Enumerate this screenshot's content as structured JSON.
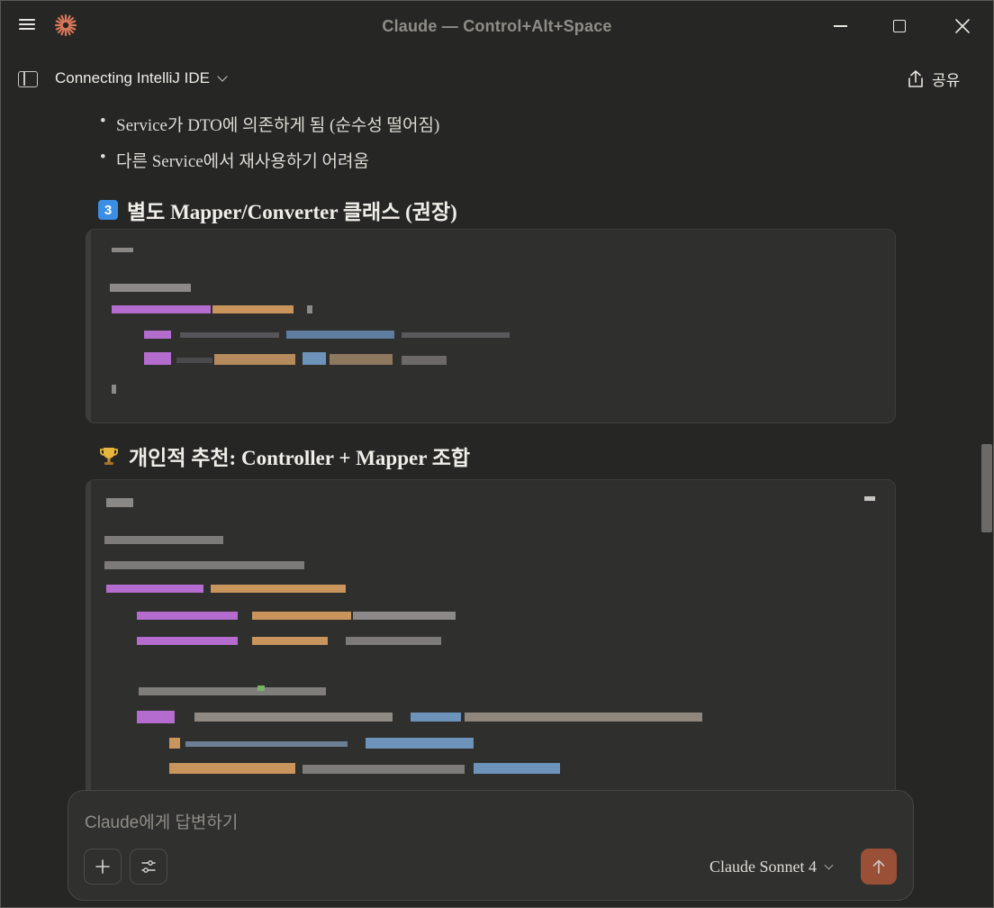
{
  "window": {
    "title": "Claude — Control+Alt+Space"
  },
  "header": {
    "chat_title": "Connecting IntelliJ IDE",
    "share_label": "공유"
  },
  "conversation": {
    "bullets": [
      "Service가 DTO에 의존하게 됨 (순수성 떨어짐)",
      "다른 Service에서 재사용하기 어려움"
    ],
    "section_3": {
      "badge": "3",
      "title": "별도 Mapper/Converter 클래스 (권장)"
    },
    "recommendation": {
      "title": "개인적 추천: Controller + Mapper 조합"
    }
  },
  "composer": {
    "placeholder": "Claude에게 답변하기",
    "model": "Claude Sonnet 4"
  },
  "colors": {
    "background": "#262624",
    "code_background": "#2f2f2d",
    "accent_send": "#b2573a",
    "badge_blue": "#3a8ee6",
    "code_purple": "#c07fd6",
    "code_orange": "#d6a06a",
    "code_blue": "#6ea8e0",
    "code_gray": "#a5a3a0"
  },
  "icons": {
    "menu": "hamburger-icon",
    "logo": "claude-asterisk-icon",
    "minimize": "minimize-icon",
    "maximize": "maximize-icon",
    "close": "close-icon",
    "sidebar": "sidebar-icon",
    "share": "share-icon",
    "plus": "plus-icon",
    "tune": "sliders-icon",
    "send": "arrow-up-icon",
    "trophy": "trophy-icon"
  }
}
